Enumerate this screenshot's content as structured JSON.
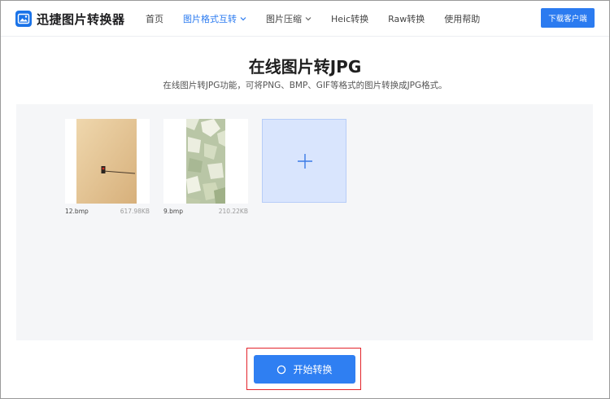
{
  "brand": {
    "name": "迅捷图片转换器"
  },
  "nav": {
    "items": [
      {
        "label": "首页",
        "active": false,
        "has_dropdown": false
      },
      {
        "label": "图片格式互转",
        "active": true,
        "has_dropdown": true
      },
      {
        "label": "图片压缩",
        "active": false,
        "has_dropdown": true
      },
      {
        "label": "Heic转换",
        "active": false,
        "has_dropdown": false
      },
      {
        "label": "Raw转换",
        "active": false,
        "has_dropdown": false
      },
      {
        "label": "使用帮助",
        "active": false,
        "has_dropdown": false
      }
    ]
  },
  "header": {
    "download_label": "下载客户端"
  },
  "hero": {
    "title": "在线图片转JPG",
    "subtitle": "在线图片转JPG功能，可将PNG、BMP、GIF等格式的图片转换成JPG格式。"
  },
  "files": [
    {
      "name": "12.bmp",
      "size": "617.98KB"
    },
    {
      "name": "9.bmp",
      "size": "210.22KB"
    }
  ],
  "action": {
    "start_label": "开始转换"
  },
  "colors": {
    "accent": "#2b7bf0",
    "add_tile": "#d9e5fd",
    "upload_bg": "#f5f6f8",
    "highlight": "#e3242b"
  }
}
